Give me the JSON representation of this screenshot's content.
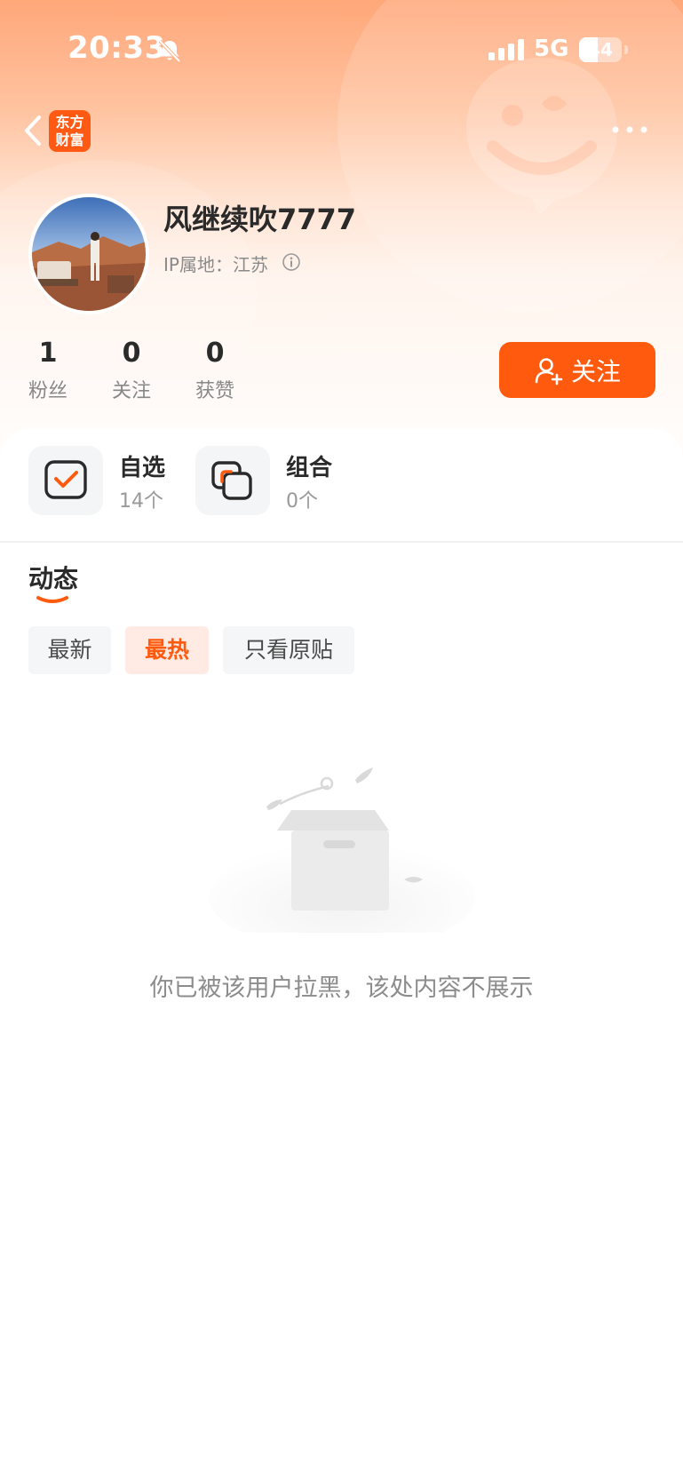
{
  "status_bar": {
    "time": "20:33",
    "network": "5G",
    "battery": "44",
    "battery_level_percent": 44
  },
  "header": {
    "logo_line1": "东方",
    "logo_line2": "财富",
    "back_icon": "chevron-left-icon",
    "more_icon": "more-horizontal-icon"
  },
  "profile": {
    "username": "风继续吹7777",
    "ip_location": "IP属地：江苏",
    "stats": [
      {
        "value": "1",
        "label": "粉丝"
      },
      {
        "value": "0",
        "label": "关注"
      },
      {
        "value": "0",
        "label": "获赞"
      }
    ],
    "follow_label": "关注"
  },
  "cards": [
    {
      "title": "自选",
      "sub": "14个",
      "icon": "checkbox-icon"
    },
    {
      "title": "组合",
      "sub": "0个",
      "icon": "stacked-squares-icon"
    }
  ],
  "feed": {
    "section_title": "动态",
    "filters": [
      "最新",
      "最热",
      "只看原贴"
    ],
    "active_filter": "最热",
    "empty_message": "你已被该用户拉黑，该处内容不展示"
  },
  "colors": {
    "accent": "#ff5a0e",
    "header_top": "#ffa779",
    "chip_active_bg": "#ffebe3"
  }
}
